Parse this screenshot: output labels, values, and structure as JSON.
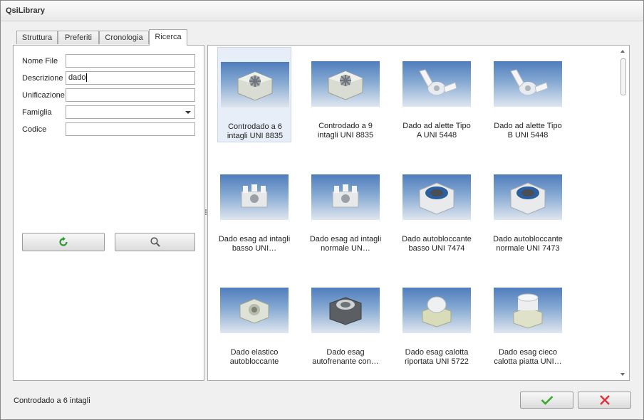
{
  "window": {
    "title": "QsiLibrary"
  },
  "tabs": [
    {
      "label": "Struttura",
      "active": false
    },
    {
      "label": "Preferiti",
      "active": false
    },
    {
      "label": "Cronologia",
      "active": false
    },
    {
      "label": "Ricerca",
      "active": true
    }
  ],
  "search_form": {
    "fields": [
      {
        "label": "Nome File",
        "value": ""
      },
      {
        "label": "Descrizione",
        "value": "dado"
      },
      {
        "label": "Unificazione",
        "value": ""
      },
      {
        "label": "Famiglia",
        "value": ""
      },
      {
        "label": "Codice",
        "value": ""
      }
    ],
    "reset_icon": "refresh-icon",
    "search_icon": "search-icon"
  },
  "results": [
    {
      "caption": "Controdado a 6 intagli UNI 8835",
      "shape": "slotted-hex",
      "selected": true
    },
    {
      "caption": "Controdado a 9 intagli UNI 8835",
      "shape": "slotted-hex",
      "selected": false
    },
    {
      "caption": "Dado ad alette Tipo A UNI 5448",
      "shape": "wing",
      "selected": false
    },
    {
      "caption": "Dado ad alette Tipo B UNI 5448",
      "shape": "wing",
      "selected": false
    },
    {
      "caption": "Dado esag ad intagli basso UNI…",
      "shape": "castle",
      "selected": false
    },
    {
      "caption": "Dado esag ad intagli normale UN…",
      "shape": "castle",
      "selected": false
    },
    {
      "caption": "Dado autobloccante basso UNI 7474",
      "shape": "nylon",
      "selected": false
    },
    {
      "caption": "Dado autobloccante normale UNI 7473",
      "shape": "nylon",
      "selected": false
    },
    {
      "caption": "Dado elastico autobloccante",
      "shape": "elastic",
      "selected": false
    },
    {
      "caption": "Dado esag autofrenante con…",
      "shape": "dark-lock",
      "selected": false
    },
    {
      "caption": "Dado esag calotta riportata UNI 5722",
      "shape": "cap-dome",
      "selected": false
    },
    {
      "caption": "Dado esag cieco calotta piatta UNI…",
      "shape": "cap-flat",
      "selected": false
    }
  ],
  "status": {
    "text": "Controdado a 6 intagli"
  },
  "footer": {
    "ok_icon": "check-icon",
    "cancel_icon": "close-icon"
  },
  "colors": {
    "ok": "#3aaa35",
    "cancel": "#e0303a",
    "thumb_top": "#4f7dbc",
    "thumb_bottom": "#dfe6ef"
  }
}
